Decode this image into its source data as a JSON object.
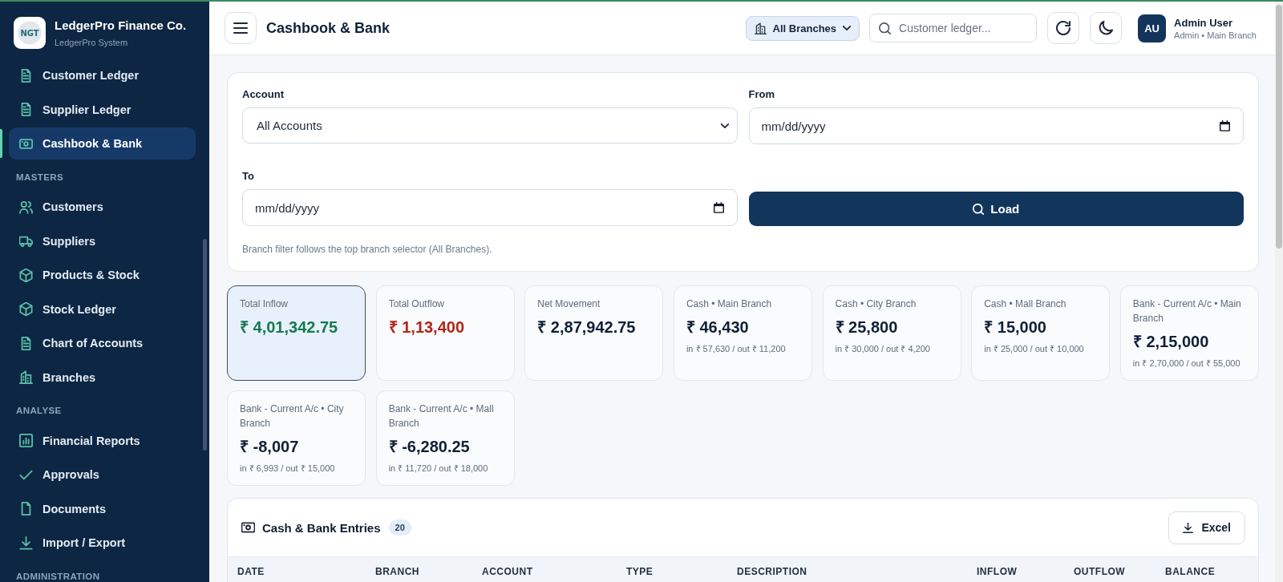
{
  "brand": {
    "logo_text": "NGT",
    "name": "LedgerPro Finance Co.",
    "subtitle": "LedgerPro System"
  },
  "sidebar": {
    "groups": [
      {
        "items": [
          {
            "label": "Customer Ledger",
            "selected": false
          },
          {
            "label": "Supplier Ledger",
            "selected": false
          },
          {
            "label": "Cashbook & Bank",
            "selected": true
          }
        ]
      },
      {
        "heading": "MASTERS",
        "items": [
          {
            "label": "Customers",
            "selected": false
          },
          {
            "label": "Suppliers",
            "selected": false
          },
          {
            "label": "Products & Stock",
            "selected": false
          },
          {
            "label": "Stock Ledger",
            "selected": false
          },
          {
            "label": "Chart of Accounts",
            "selected": false
          },
          {
            "label": "Branches",
            "selected": false
          }
        ]
      },
      {
        "heading": "ANALYSE",
        "items": [
          {
            "label": "Financial Reports",
            "selected": false
          },
          {
            "label": "Approvals",
            "selected": false
          },
          {
            "label": "Documents",
            "selected": false
          },
          {
            "label": "Import / Export",
            "selected": false
          }
        ]
      },
      {
        "heading": "ADMINISTRATION"
      }
    ]
  },
  "header": {
    "title": "Cashbook & Bank",
    "branch_selector": "All Branches",
    "search": {
      "placeholder": "Customer ledger..."
    },
    "user": {
      "initials": "AU",
      "name": "Admin User",
      "role": "Admin • Main Branch"
    }
  },
  "filters": {
    "account": {
      "label": "Account",
      "value": "All Accounts"
    },
    "from": {
      "label": "From",
      "placeholder": "mm/dd/yyyy"
    },
    "to": {
      "label": "To",
      "placeholder": "mm/dd/yyyy"
    },
    "load_button": "Load",
    "note": "Branch filter follows the top branch selector (All Branches)."
  },
  "stats": [
    {
      "label": "Total Inflow",
      "value": "₹ 4,01,342.75",
      "kind": "inflow",
      "selected": true
    },
    {
      "label": "Total Outflow",
      "value": "₹ 1,13,400",
      "kind": "outflow",
      "selected": false
    },
    {
      "label": "Net Movement",
      "value": "₹ 2,87,942.75",
      "kind": "balance",
      "selected": false
    },
    {
      "label": "Cash • Main Branch",
      "value": "₹ 46,430",
      "detail": "in ₹ 57,630 / out ₹ 11,200",
      "kind": "balance",
      "selected": false
    },
    {
      "label": "Cash • City Branch",
      "value": "₹ 25,800",
      "detail": "in ₹ 30,000 / out ₹ 4,200",
      "kind": "balance",
      "selected": false
    },
    {
      "label": "Cash • Mall Branch",
      "value": "₹ 15,000",
      "detail": "in ₹ 25,000 / out ₹ 10,000",
      "kind": "balance",
      "selected": false
    },
    {
      "label": "Bank - Current A/c • Main Branch",
      "value": "₹ 2,15,000",
      "detail": "in ₹ 2,70,000 / out ₹ 55,000",
      "kind": "balance",
      "selected": false
    },
    {
      "label": "Bank - Current A/c • City Branch",
      "value": "₹ -8,007",
      "detail": "in ₹ 6,993 / out ₹ 15,000",
      "kind": "balance",
      "selected": false
    },
    {
      "label": "Bank - Current A/c • Mall Branch",
      "value": "₹ -6,280.25",
      "detail": "in ₹ 11,720 / out ₹ 18,000",
      "kind": "balance",
      "selected": false
    }
  ],
  "entries": {
    "title": "Cash & Bank Entries",
    "count": "20",
    "export_button": "Excel",
    "columns": [
      "DATE",
      "BRANCH",
      "ACCOUNT",
      "TYPE",
      "DESCRIPTION",
      "INFLOW",
      "OUTFLOW",
      "BALANCE"
    ]
  }
}
